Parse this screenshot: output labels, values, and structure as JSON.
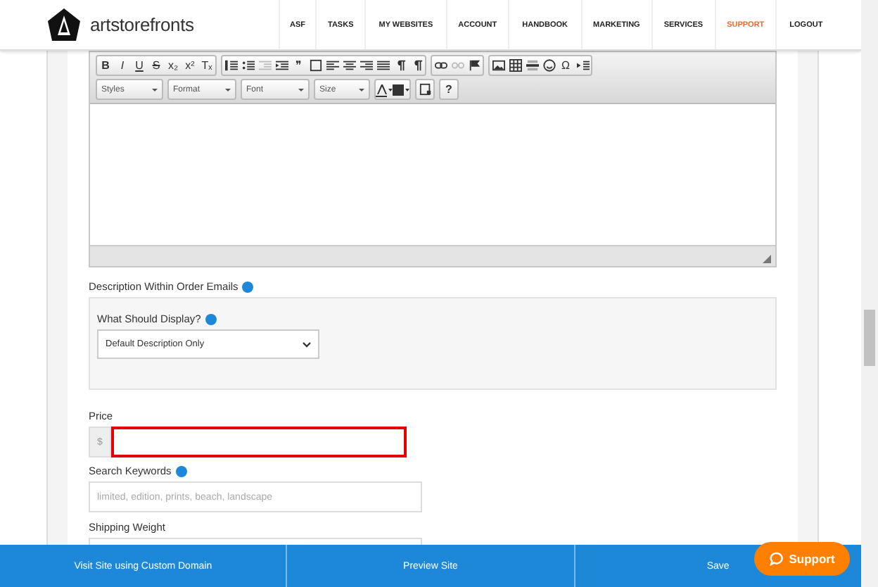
{
  "header": {
    "brand": "artstorefronts",
    "nav": [
      {
        "label": "ASF",
        "selected": false
      },
      {
        "label": "TASKS",
        "selected": false
      },
      {
        "label": "MY WEBSITES",
        "selected": false
      },
      {
        "label": "ACCOUNT",
        "selected": false
      },
      {
        "label": "HANDBOOK",
        "selected": false
      },
      {
        "label": "MARKETING",
        "selected": false
      },
      {
        "label": "SERVICES",
        "selected": false
      },
      {
        "label": "SUPPORT",
        "selected": true
      },
      {
        "label": "LOGOUT",
        "selected": false
      }
    ]
  },
  "editor": {
    "toolbar_groups": [
      [
        {
          "kind": "text",
          "label": "B",
          "disabled": false
        },
        {
          "kind": "text",
          "label": "I",
          "disabled": false
        },
        {
          "kind": "text",
          "label": "U",
          "disabled": false
        },
        {
          "kind": "text",
          "label": "S",
          "disabled": false
        },
        {
          "kind": "text",
          "label": "x₂",
          "disabled": false
        },
        {
          "kind": "text",
          "label": "x²",
          "disabled": false
        },
        {
          "kind": "text",
          "label": "Tₓ",
          "disabled": false
        }
      ],
      [
        {
          "kind": "icon",
          "disabled": false
        },
        {
          "kind": "icon",
          "disabled": false
        },
        {
          "kind": "icon",
          "disabled": true
        },
        {
          "kind": "icon",
          "disabled": false
        },
        {
          "kind": "text",
          "label": "❞",
          "disabled": false
        },
        {
          "kind": "icon",
          "disabled": false
        },
        {
          "kind": "icon",
          "disabled": false
        },
        {
          "kind": "icon",
          "disabled": false
        },
        {
          "kind": "icon",
          "disabled": false
        },
        {
          "kind": "icon",
          "disabled": false
        },
        {
          "kind": "icon",
          "disabled": false
        },
        {
          "kind": "icon",
          "disabled": false
        }
      ],
      [
        {
          "kind": "icon",
          "disabled": false
        },
        {
          "kind": "icon",
          "disabled": true
        },
        {
          "kind": "icon",
          "disabled": false
        }
      ],
      [
        {
          "kind": "icon",
          "disabled": false
        },
        {
          "kind": "icon",
          "disabled": false
        },
        {
          "kind": "icon",
          "disabled": false
        },
        {
          "kind": "icon",
          "disabled": false
        },
        {
          "kind": "text",
          "label": "Ω",
          "disabled": false
        },
        {
          "kind": "icon",
          "disabled": false
        }
      ]
    ],
    "dropdowns": [
      "Styles",
      "Format",
      "Font",
      "Size"
    ],
    "help": "?"
  },
  "order_emails": {
    "label": "Description Within Order Emails",
    "display_label": "What Should Display?",
    "display_value": "Default Description Only"
  },
  "price": {
    "label": "Price",
    "prefix": "$",
    "error": true
  },
  "keywords": {
    "label": "Search Keywords",
    "placeholder": "limited, edition, prints, beach, landscape"
  },
  "shipping": {
    "label": "Shipping Weight"
  },
  "bottom_bar": [
    "Visit Site using Custom Domain",
    "Preview Site",
    "Save"
  ],
  "support_button": "Support"
}
